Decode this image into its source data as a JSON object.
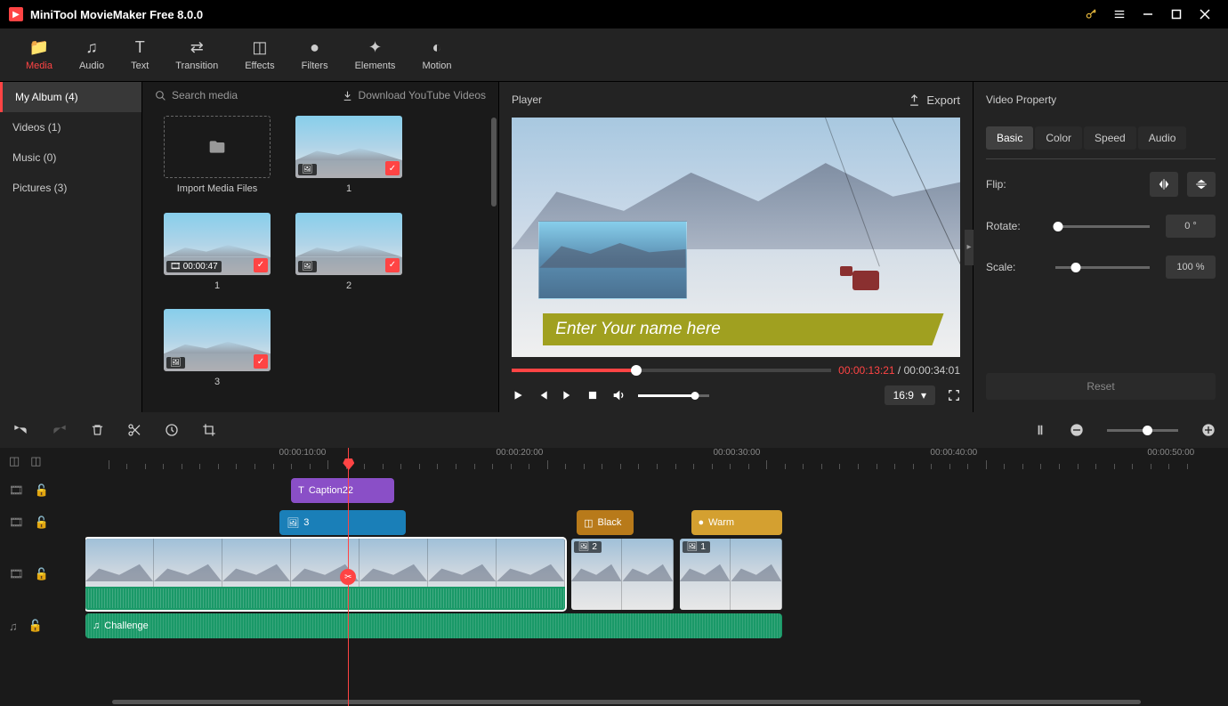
{
  "app": {
    "title": "MiniTool MovieMaker Free 8.0.0"
  },
  "toolbar": {
    "tabs": [
      {
        "label": "Media"
      },
      {
        "label": "Audio"
      },
      {
        "label": "Text"
      },
      {
        "label": "Transition"
      },
      {
        "label": "Effects"
      },
      {
        "label": "Filters"
      },
      {
        "label": "Elements"
      },
      {
        "label": "Motion"
      }
    ]
  },
  "sidebar": {
    "items": [
      {
        "label": "My Album (4)"
      },
      {
        "label": "Videos (1)"
      },
      {
        "label": "Music (0)"
      },
      {
        "label": "Pictures (3)"
      }
    ]
  },
  "mediapanel": {
    "search_placeholder": "Search media",
    "download_label": "Download YouTube Videos",
    "import_label": "Import Media Files",
    "items": [
      {
        "label": "1",
        "type": "image"
      },
      {
        "label": "1",
        "type": "video",
        "duration": "00:00:47"
      },
      {
        "label": "2",
        "type": "image"
      },
      {
        "label": "3",
        "type": "image"
      }
    ]
  },
  "player": {
    "title": "Player",
    "export_label": "Export",
    "caption_text": "Enter Your name here",
    "current_time": "00:00:13:21",
    "total_time": "00:00:34:01",
    "progress_pct": 39,
    "aspect_ratio": "16:9"
  },
  "property": {
    "title": "Video Property",
    "tabs": [
      {
        "label": "Basic"
      },
      {
        "label": "Color"
      },
      {
        "label": "Speed"
      },
      {
        "label": "Audio"
      }
    ],
    "flip_label": "Flip:",
    "rotate_label": "Rotate:",
    "rotate_value": "0 °",
    "scale_label": "Scale:",
    "scale_value": "100 %",
    "reset_label": "Reset"
  },
  "timeline": {
    "ticks": [
      "00:00:10:00",
      "00:00:20:00",
      "00:00:30:00",
      "00:00:40:00",
      "00:00:50:00"
    ],
    "playhead_pct": 23,
    "clips": {
      "caption": {
        "label": "Caption22"
      },
      "pip": {
        "label": "3"
      },
      "trans": {
        "label": "Black"
      },
      "filter": {
        "label": "Warm"
      },
      "video2": {
        "label": "2"
      },
      "video3": {
        "label": "1"
      },
      "audio": {
        "label": "Challenge"
      }
    }
  }
}
